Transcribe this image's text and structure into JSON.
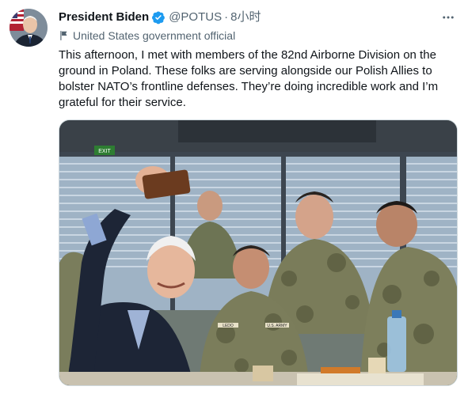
{
  "author": {
    "display_name": "President Biden",
    "handle": "@POTUS",
    "separator": "·",
    "time": "8小时",
    "verified": true,
    "verified_icon": "verified-badge-icon",
    "verified_color": "#1d9bf0"
  },
  "label": {
    "icon": "flag-icon",
    "text": "United States government official"
  },
  "more_icon": "more-horizontal-icon",
  "tweet": {
    "text": "This afternoon, I met with members of the 82nd Airborne Division on the ground in Poland. These folks are serving alongside our Polish Allies to bolster NATO’s frontline defenses. They’re doing incredible work and I’m grateful for their service."
  },
  "media": {
    "exit_sign": "EXIT",
    "uniform_tapes": [
      "LEDO",
      "U.S. ARMY"
    ]
  },
  "colors": {
    "text": "#0f1419",
    "secondary": "#536471",
    "border": "#cfd9de"
  }
}
